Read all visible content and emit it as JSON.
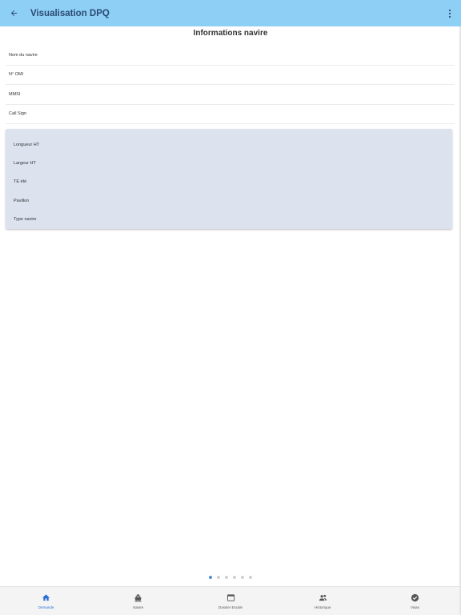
{
  "appbar": {
    "title": "Visualisation DPQ",
    "back_icon": "arrow-left-icon",
    "menu_icon": "more-vertical-icon",
    "color": "#8ecff5"
  },
  "section": {
    "title": "Informations navire"
  },
  "fields": [
    {
      "label": "Nom du navire"
    },
    {
      "label": "N° OMI"
    },
    {
      "label": "MMSI"
    },
    {
      "label": "Call Sign"
    }
  ],
  "card": {
    "color": "#dce3ef",
    "fields": [
      {
        "label": "Longueur HT"
      },
      {
        "label": "Largeur HT"
      },
      {
        "label": "TE été"
      },
      {
        "label": "Pavillon"
      },
      {
        "label": "Type navire"
      }
    ]
  },
  "pager": {
    "count": 6,
    "active_index": 0
  },
  "bottom_nav": {
    "active_color": "#2b6fd6",
    "items": [
      {
        "label": "Demande",
        "icon": "home-icon",
        "active": true
      },
      {
        "label": "Navire",
        "icon": "ship-icon",
        "active": false
      },
      {
        "label": "Dossier Escale",
        "icon": "calendar-icon",
        "active": false
      },
      {
        "label": "Historique",
        "icon": "history-icon",
        "active": false
      },
      {
        "label": "Visas",
        "icon": "check-circle-icon",
        "active": false
      }
    ]
  }
}
